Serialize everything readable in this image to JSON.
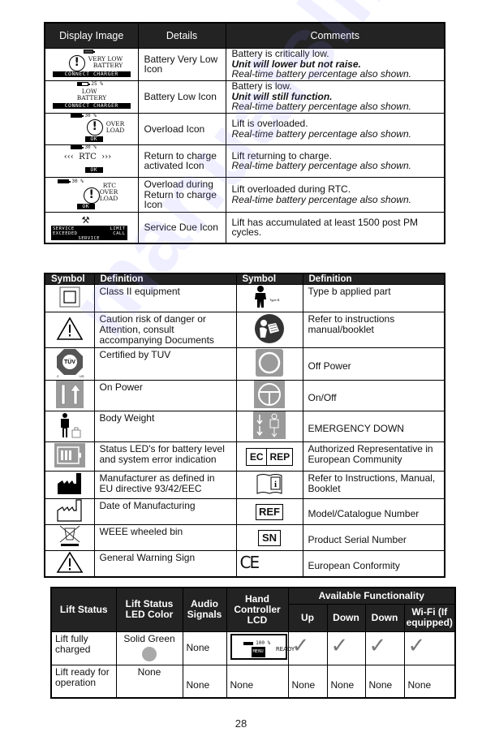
{
  "display_table": {
    "headers": [
      "Display Image",
      "Details",
      "Comments"
    ],
    "rows": [
      {
        "lcd": {
          "battery": "",
          "icon": "warning-circle",
          "text": [
            "VERY LOW",
            "BATTERY"
          ],
          "bar": "CONNECT CHARGER"
        },
        "details": "Battery Very Low Icon",
        "comment_line1": "Battery is critically low.",
        "comment_bold": "Unit will lower but not raise.",
        "comment_italic": "Real-time battery percentage also shown."
      },
      {
        "lcd": {
          "battery": "25 %",
          "icon": "",
          "text": [
            "LOW",
            "BATTERY"
          ],
          "bar": "CONNECT CHARGER"
        },
        "details": "Battery Low Icon",
        "comment_line1": "Battery is low.",
        "comment_bold": "Unit will still function.",
        "comment_italic": "Real-time battery percentage also shown."
      },
      {
        "lcd": {
          "battery": "30 %",
          "icon": "warning-circle",
          "text": [
            "OVER",
            "LOAD"
          ],
          "bar": "OK"
        },
        "details": "Overload Icon",
        "comment_line1": "Lift is overloaded.",
        "comment_bold": "",
        "comment_italic": "Real-time battery percentage also shown."
      },
      {
        "lcd": {
          "battery": "30 %",
          "icon": "",
          "text": [
            "‹‹‹  RTC  ›››"
          ],
          "bar": "OK"
        },
        "details": "Return to charge activated Icon",
        "comment_line1": "Lift returning to charge.",
        "comment_bold": "",
        "comment_italic": "Real-time battery percentage also shown."
      },
      {
        "lcd": {
          "battery": "30 %",
          "icon": "warning-circle",
          "text": [
            "RTC",
            "OVER",
            "LOAD"
          ],
          "bar": "OK"
        },
        "details": "Overload during Return to charge Icon",
        "comment_line1": "Lift overloaded during RTC.",
        "comment_bold": "",
        "comment_italic": "Real-time battery percentage also shown."
      },
      {
        "lcd": {
          "battery": "",
          "icon": "wrench-screwdriver",
          "text": [],
          "bar": "SERVICE LIMIT EXCEEDED CALL SERVICE"
        },
        "details": "Service Due Icon",
        "comment_line1": "Lift has accumulated at least 1500 post PM cycles.",
        "comment_bold": "",
        "comment_italic": ""
      }
    ]
  },
  "symbol_table": {
    "headers": [
      "Symbol",
      "Definition",
      "Symbol",
      "Definition"
    ],
    "rows": [
      {
        "left_icon": "class-ii-equipment-icon",
        "left_def": "Class II equipment",
        "right_icon": "type-b-applied-part-icon",
        "right_def": "Type b applied part",
        "right_icon_caption": "Type B"
      },
      {
        "left_icon": "caution-triangle-icon",
        "left_def": "Caution risk of danger or Attention, consult accompanying Documents",
        "right_icon": "refer-to-manual-icon",
        "right_def": "Refer to instructions manual/booklet"
      },
      {
        "left_icon": "tuv-certified-icon",
        "left_def": "Certified by TUV",
        "right_icon": "off-power-icon",
        "right_def": "Off Power",
        "left_icon_caption": "TÜV",
        "left_icon_sub": [
          "C",
          "US"
        ]
      },
      {
        "left_icon": "on-power-icon",
        "left_def": "On Power",
        "right_icon": "on-off-icon",
        "right_def": "On/Off"
      },
      {
        "left_icon": "body-weight-icon",
        "left_def": "Body Weight",
        "right_icon": "emergency-down-icon",
        "right_def": "EMERGENCY DOWN"
      },
      {
        "left_icon": "status-led-battery-icon",
        "left_def": "Status LED's for battery level and system error indication",
        "right_icon": "ec-rep-icon",
        "right_def": "Authorized Representative in European Community",
        "right_icon_labels": [
          "EC",
          "REP"
        ]
      },
      {
        "left_icon": "manufacturer-icon",
        "left_def": "Manufacturer as defined in EU directive 93/42/EEC",
        "right_icon": "instructions-info-icon",
        "right_def": "Refer to Instructions, Manual, Booklet",
        "right_icon_caption": "i"
      },
      {
        "left_icon": "date-of-manufacture-icon",
        "left_def": "Date of Manufacturing",
        "right_icon": "ref-icon",
        "right_def": "Model/Catalogue Number",
        "right_icon_caption": "REF"
      },
      {
        "left_icon": "weee-bin-icon",
        "left_def": "WEEE wheeled bin",
        "right_icon": "serial-number-icon",
        "right_def": "Product Serial Number",
        "right_icon_caption": "SN"
      },
      {
        "left_icon": "general-warning-icon",
        "left_def": "General Warning Sign",
        "right_icon": "ce-mark-icon",
        "right_def": "European Conformity",
        "right_icon_caption": "CE"
      }
    ]
  },
  "status_table": {
    "headers": {
      "lift_status": "Lift Status",
      "led_color": "Lift Status LED Color",
      "audio": "Audio Signals",
      "lcd": "Hand Controller LCD",
      "functionality": "Available Functionality",
      "sub": [
        "Up",
        "Down",
        "Down",
        "Wi-Fi (If equipped)"
      ]
    },
    "rows": [
      {
        "status": "Lift fully charged",
        "led": "Solid Green",
        "led_color": "#a9a9a9",
        "audio": "None",
        "lcd": {
          "battery": "100 %",
          "text": "READY",
          "bar": "MENU"
        },
        "functions": [
          "✓",
          "✓",
          "✓",
          "✓"
        ]
      },
      {
        "status": "Lift ready for operation",
        "led": "None",
        "audio": "None",
        "lcd_text": "None",
        "functions": [
          "None",
          "None",
          "None",
          "None"
        ]
      }
    ]
  },
  "watermark": "manualslib",
  "page_number": "28"
}
